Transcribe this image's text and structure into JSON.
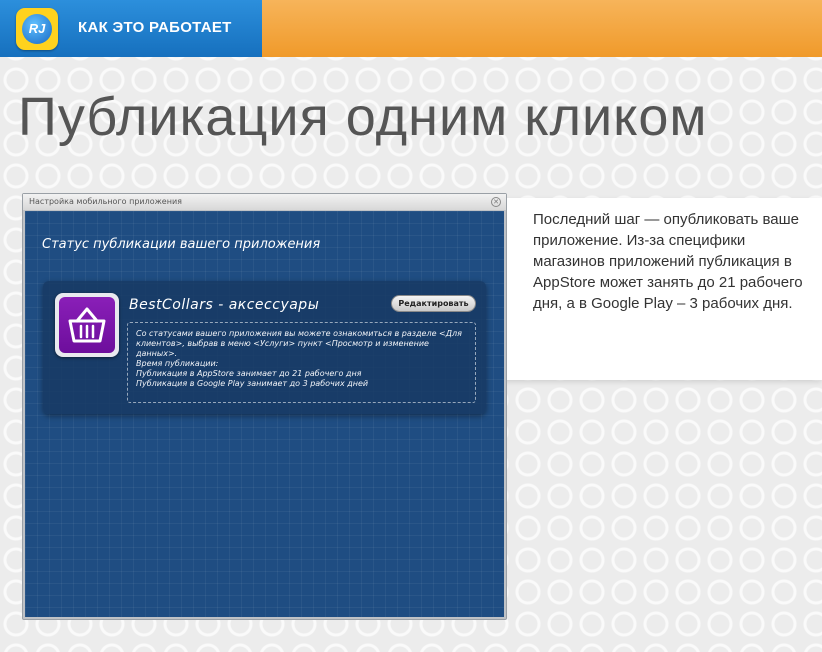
{
  "header": {
    "logo_text": "RJ",
    "title": "КАК ЭТО РАБОТАЕТ"
  },
  "page": {
    "title": "Публикация одним кликом"
  },
  "info_panel": {
    "text": "Последний шаг — опубликовать ваше приложение. Из-за специфики магазинов приложений публикация в AppStore может занять до 21 рабочего дня, а в Google Play – 3 рабочих дня."
  },
  "window": {
    "title": "Настройка мобильного приложения",
    "close_glyph": "✕",
    "heading": "Статус публикации вашего приложения",
    "app_card": {
      "app_name": "BestCollars - аксессуары",
      "edit_label": "Редактировать",
      "info_line": "Со статусами вашего приложения вы можете ознакомиться в разделе <Для клиентов>, выбрав в меню <Услуги> пункт <Просмотр и изменение данных>.",
      "time_label": "Время публикации:",
      "appstore_line": "Публикация в AppStore занимает до 21 рабочего дня",
      "googleplay_line": "Публикация в Google Play занимает до 3 рабочих дней"
    }
  },
  "icons": {
    "logo": "rj-logo-icon",
    "app": "shopping-basket-icon",
    "close": "close-icon"
  }
}
